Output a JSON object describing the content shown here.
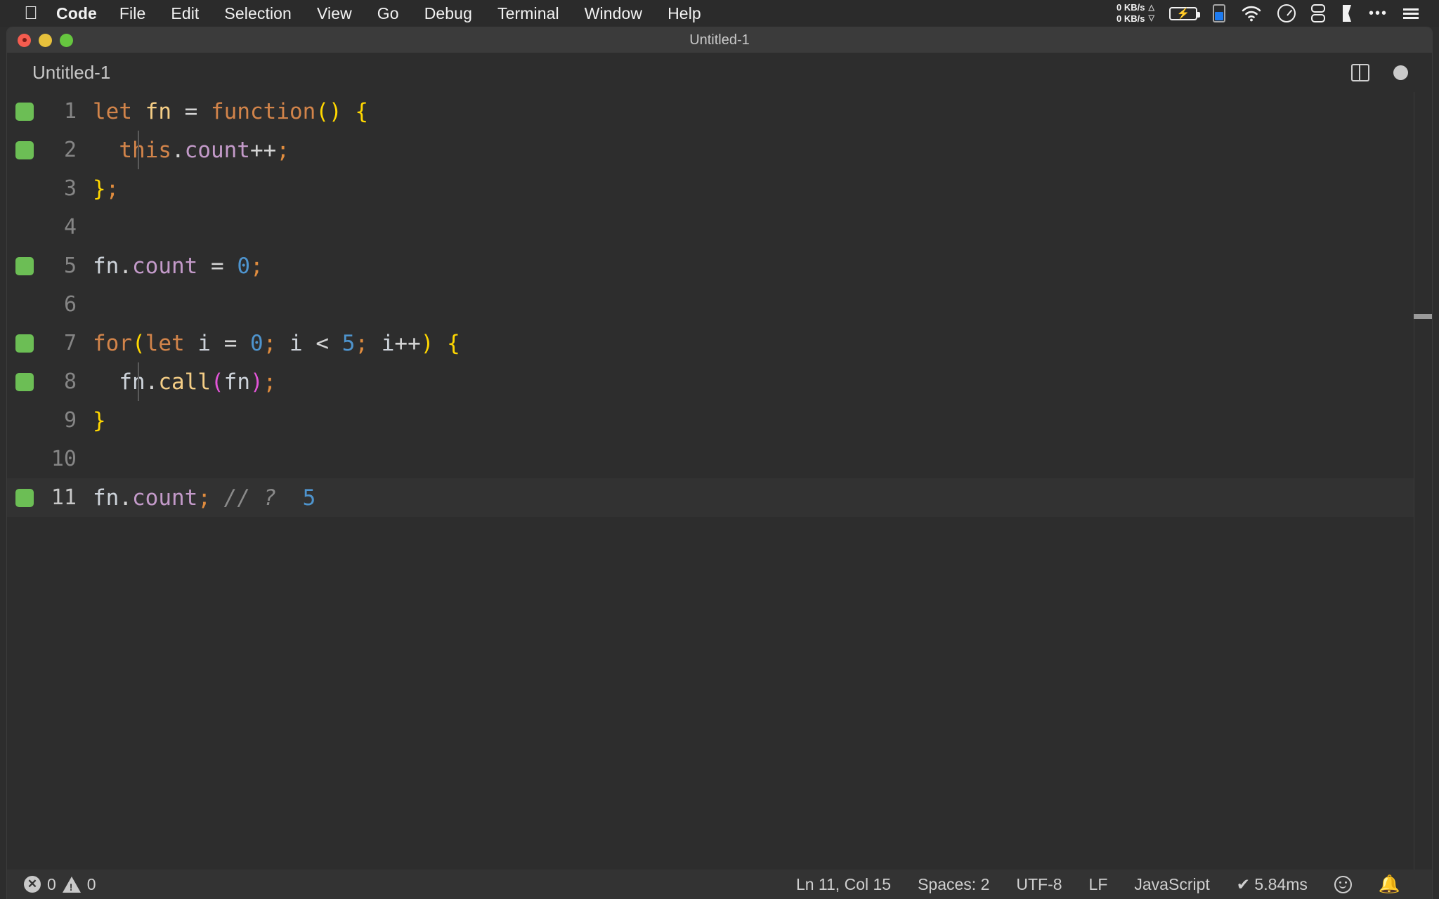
{
  "menubar": {
    "apple_icon": "apple-logo",
    "items": [
      {
        "label": "Code",
        "bold": true
      },
      {
        "label": "File",
        "bold": false
      },
      {
        "label": "Edit",
        "bold": false
      },
      {
        "label": "Selection",
        "bold": false
      },
      {
        "label": "View",
        "bold": false
      },
      {
        "label": "Go",
        "bold": false
      },
      {
        "label": "Debug",
        "bold": false
      },
      {
        "label": "Terminal",
        "bold": false
      },
      {
        "label": "Window",
        "bold": false
      },
      {
        "label": "Help",
        "bold": false
      }
    ],
    "status": {
      "net_up": "0 KB/s",
      "net_down": "0 KB/s",
      "up_arrow": "△",
      "down_arrow": "▽",
      "battery_icon": "battery-charging-icon",
      "meter_icon": "blue-level-meter-icon",
      "wifi_icon": "wifi-icon",
      "clock_icon": "clock-icon",
      "switch_icon": "toggle-switch-icon",
      "flag_icon": "flag-icon",
      "more_icon": "ellipsis-icon",
      "list_icon": "list-icon"
    }
  },
  "window": {
    "title": "Untitled-1",
    "traffic_lights": [
      "close",
      "minimize",
      "zoom"
    ]
  },
  "tabbar": {
    "tabs": [
      {
        "label": "Untitled-1",
        "active": true
      }
    ],
    "split_editor_label": "split-editor",
    "dirty_indicator": "unsaved-changes"
  },
  "editor": {
    "language": "JavaScript",
    "active_line": 11,
    "lines": [
      {
        "num": "1",
        "coverage": true,
        "tokens": [
          {
            "t": "let",
            "c": "t-kw"
          },
          {
            "t": " ",
            "c": "t-plain"
          },
          {
            "t": "fn",
            "c": "t-var"
          },
          {
            "t": " ",
            "c": "t-plain"
          },
          {
            "t": "=",
            "c": "t-op"
          },
          {
            "t": " ",
            "c": "t-plain"
          },
          {
            "t": "function",
            "c": "t-kw"
          },
          {
            "t": "()",
            "c": "t-paren"
          },
          {
            "t": " ",
            "c": "t-plain"
          },
          {
            "t": "{",
            "c": "t-paren"
          }
        ]
      },
      {
        "num": "2",
        "coverage": true,
        "indent": true,
        "tokens": [
          {
            "t": "  ",
            "c": "t-plain"
          },
          {
            "t": "this",
            "c": "t-this"
          },
          {
            "t": ".",
            "c": "t-op"
          },
          {
            "t": "count",
            "c": "t-prop"
          },
          {
            "t": "++",
            "c": "t-op"
          },
          {
            "t": ";",
            "c": "t-semi"
          }
        ]
      },
      {
        "num": "3",
        "coverage": false,
        "tokens": [
          {
            "t": "}",
            "c": "t-paren"
          },
          {
            "t": ";",
            "c": "t-semi"
          }
        ]
      },
      {
        "num": "4",
        "coverage": false,
        "tokens": []
      },
      {
        "num": "5",
        "coverage": true,
        "tokens": [
          {
            "t": "fn",
            "c": "t-ident"
          },
          {
            "t": ".",
            "c": "t-op"
          },
          {
            "t": "count",
            "c": "t-prop"
          },
          {
            "t": " ",
            "c": "t-plain"
          },
          {
            "t": "=",
            "c": "t-op"
          },
          {
            "t": " ",
            "c": "t-plain"
          },
          {
            "t": "0",
            "c": "t-num"
          },
          {
            "t": ";",
            "c": "t-semi"
          }
        ]
      },
      {
        "num": "6",
        "coverage": false,
        "tokens": []
      },
      {
        "num": "7",
        "coverage": true,
        "tokens": [
          {
            "t": "for",
            "c": "t-kw"
          },
          {
            "t": "(",
            "c": "t-paren"
          },
          {
            "t": "let",
            "c": "t-kw"
          },
          {
            "t": " ",
            "c": "t-plain"
          },
          {
            "t": "i",
            "c": "t-ident"
          },
          {
            "t": " ",
            "c": "t-plain"
          },
          {
            "t": "=",
            "c": "t-op"
          },
          {
            "t": " ",
            "c": "t-plain"
          },
          {
            "t": "0",
            "c": "t-num"
          },
          {
            "t": ";",
            "c": "t-semi"
          },
          {
            "t": " ",
            "c": "t-plain"
          },
          {
            "t": "i",
            "c": "t-ident"
          },
          {
            "t": " ",
            "c": "t-plain"
          },
          {
            "t": "<",
            "c": "t-op"
          },
          {
            "t": " ",
            "c": "t-plain"
          },
          {
            "t": "5",
            "c": "t-num"
          },
          {
            "t": ";",
            "c": "t-semi"
          },
          {
            "t": " ",
            "c": "t-plain"
          },
          {
            "t": "i",
            "c": "t-ident"
          },
          {
            "t": "++",
            "c": "t-op"
          },
          {
            "t": ")",
            "c": "t-paren"
          },
          {
            "t": " ",
            "c": "t-plain"
          },
          {
            "t": "{",
            "c": "t-paren"
          }
        ]
      },
      {
        "num": "8",
        "coverage": true,
        "indent": true,
        "tokens": [
          {
            "t": "  ",
            "c": "t-plain"
          },
          {
            "t": "fn",
            "c": "t-ident"
          },
          {
            "t": ".",
            "c": "t-op"
          },
          {
            "t": "call",
            "c": "t-var"
          },
          {
            "t": "(",
            "c": "t-paren2"
          },
          {
            "t": "fn",
            "c": "t-ident"
          },
          {
            "t": ")",
            "c": "t-paren2"
          },
          {
            "t": ";",
            "c": "t-semi"
          }
        ]
      },
      {
        "num": "9",
        "coverage": false,
        "tokens": [
          {
            "t": "}",
            "c": "t-paren"
          }
        ]
      },
      {
        "num": "10",
        "coverage": false,
        "tokens": []
      },
      {
        "num": "11",
        "coverage": true,
        "active": true,
        "tokens": [
          {
            "t": "fn",
            "c": "t-ident"
          },
          {
            "t": ".",
            "c": "t-op"
          },
          {
            "t": "count",
            "c": "t-prop"
          },
          {
            "t": ";",
            "c": "t-semi"
          },
          {
            "t": " ",
            "c": "t-plain"
          },
          {
            "t": "// ?",
            "c": "t-comment"
          },
          {
            "t": "  ",
            "c": "t-plain"
          },
          {
            "t": "5",
            "c": "t-num"
          }
        ]
      }
    ]
  },
  "statusbar": {
    "errors": "0",
    "warnings": "0",
    "error_icon": "error-circle-icon",
    "warning_icon": "warning-triangle-icon",
    "cursor_position": "Ln 11, Col 15",
    "indentation": "Spaces: 2",
    "encoding": "UTF-8",
    "eol": "LF",
    "language": "JavaScript",
    "runtime": "✔ 5.84ms",
    "feedback_icon": "smiley-icon",
    "notifications_icon": "bell-icon"
  },
  "colors": {
    "background": "#2d2d2d",
    "statusbar_bg": "#333333",
    "titlebar_bg": "#3b3b3b",
    "coverage_green": "#6cbe55",
    "keyword_orange": "#d2844a",
    "number_blue": "#4e94ce",
    "property_purple": "#c39ac9",
    "semicolon_orange": "#e08c3e",
    "paren_yellow": "#ffd700",
    "paren_magenta": "#e255d8"
  }
}
